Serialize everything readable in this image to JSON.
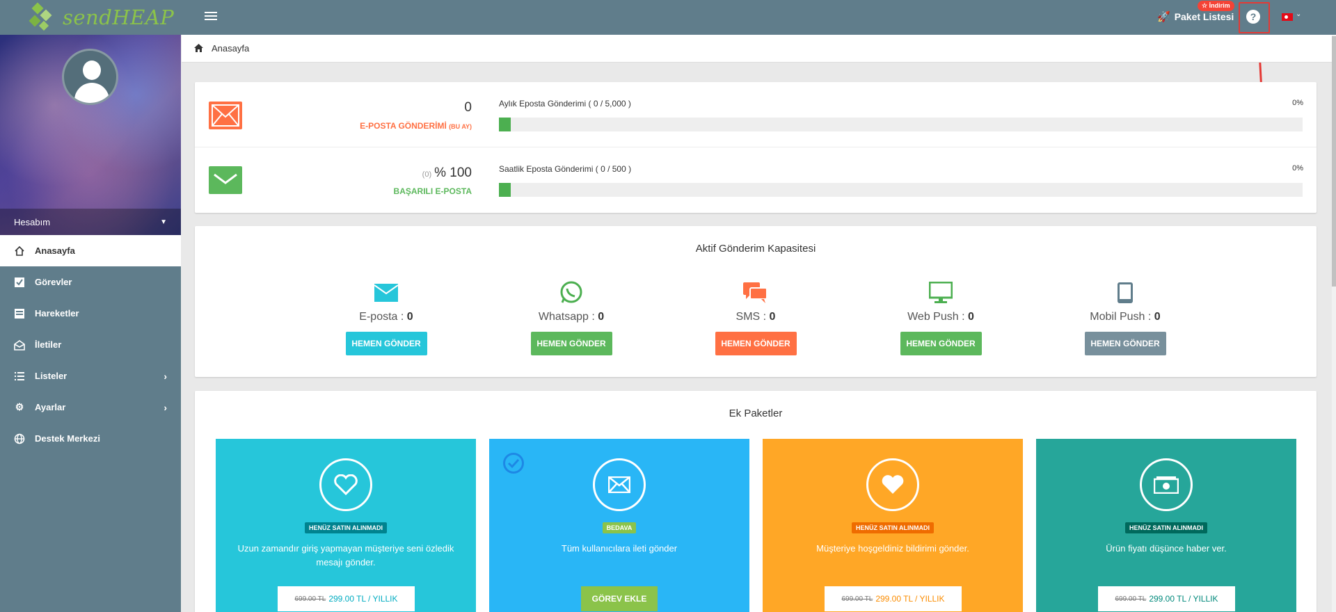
{
  "app": {
    "logo_text": "sendHEAP"
  },
  "topbar": {
    "package_list": "Paket Listesi",
    "discount_badge": "☆ İndirim",
    "help_icon": "question-circle-icon",
    "language_flag": "turkey-flag-icon"
  },
  "sidebar": {
    "account_label": "Hesabım",
    "items": [
      {
        "label": "Anasayfa",
        "icon": "home-icon"
      },
      {
        "label": "Görevler",
        "icon": "checkbox-icon"
      },
      {
        "label": "Hareketler",
        "icon": "list-box-icon"
      },
      {
        "label": "İletiler",
        "icon": "envelope-open-icon"
      },
      {
        "label": "Listeler",
        "icon": "list-icon"
      },
      {
        "label": "Ayarlar",
        "icon": "gear-icon"
      },
      {
        "label": "Destek Merkezi",
        "icon": "globe-icon"
      }
    ]
  },
  "breadcrumb": {
    "label": "Anasayfa"
  },
  "stats": {
    "email_sent": {
      "value": "0",
      "label": "E-POSTA GÖNDERİMİ",
      "suffix": "(BU AY)"
    },
    "success": {
      "count": "(0)",
      "value": "% 100",
      "label": "BAŞARILI E-POSTA"
    },
    "monthly": {
      "label": "Aylık Eposta Gönderimi ( 0 / 5,000 )",
      "percent_text": "0%",
      "fill_fraction": 0.015
    },
    "hourly": {
      "label": "Saatlik Eposta Gönderimi ( 0 / 500 )",
      "percent_text": "0%",
      "fill_fraction": 0.015
    }
  },
  "capacity": {
    "title": "Aktif Gönderim Kapasitesi",
    "channels": [
      {
        "name": "E-posta",
        "count": "0",
        "button": "HEMEN GÖNDER",
        "color": "#26c6da",
        "icon": "envelope-icon"
      },
      {
        "name": "Whatsapp",
        "count": "0",
        "button": "HEMEN GÖNDER",
        "color": "#5cb85c",
        "icon": "whatsapp-icon"
      },
      {
        "name": "SMS",
        "count": "0",
        "button": "HEMEN GÖNDER",
        "color": "#ff7043",
        "icon": "chat-bubbles-icon"
      },
      {
        "name": "Web Push",
        "count": "0",
        "button": "HEMEN GÖNDER",
        "color": "#5cb85c",
        "icon": "monitor-icon"
      },
      {
        "name": "Mobil Push",
        "count": "0",
        "button": "HEMEN GÖNDER",
        "color": "#78909c",
        "icon": "tablet-icon"
      }
    ]
  },
  "packages": {
    "title": "Ek Paketler",
    "items": [
      {
        "badge": "HENÜZ SATIN ALINMADI",
        "desc": "Uzun zamandır giriş yapmayan müşteriye seni özledik mesajı gönder.",
        "old_price": "699.00 TL",
        "price": "299.00 TL / YILLIK",
        "bg": "#26c6da",
        "badge_bg": "#00838f",
        "price_color": "#00acc1",
        "icon": "heart-outline-icon"
      },
      {
        "badge": "BEDAVA",
        "desc": "Tüm kullanıcılara ileti gönder",
        "action": "GÖREV EKLE",
        "bg": "#29b6f6",
        "badge_bg": "#8bc34a",
        "icon": "envelope-icon"
      },
      {
        "badge": "HENÜZ SATIN ALINMADI",
        "desc": "Müşteriye hoşgeldiniz bildirimi gönder.",
        "old_price": "699.00 TL",
        "price": "299.00 TL / YILLIK",
        "bg": "#ffa726",
        "badge_bg": "#ef6c00",
        "price_color": "#fb8c00",
        "icon": "heart-icon"
      },
      {
        "badge": "HENÜZ SATIN ALINMADI",
        "desc": "Ürün fiyatı düşünce haber ver.",
        "old_price": "699.00 TL",
        "price": "299.00 TL / YILLIK",
        "bg": "#26a69a",
        "badge_bg": "#00695c",
        "price_color": "#00897b",
        "icon": "money-icon"
      }
    ]
  }
}
